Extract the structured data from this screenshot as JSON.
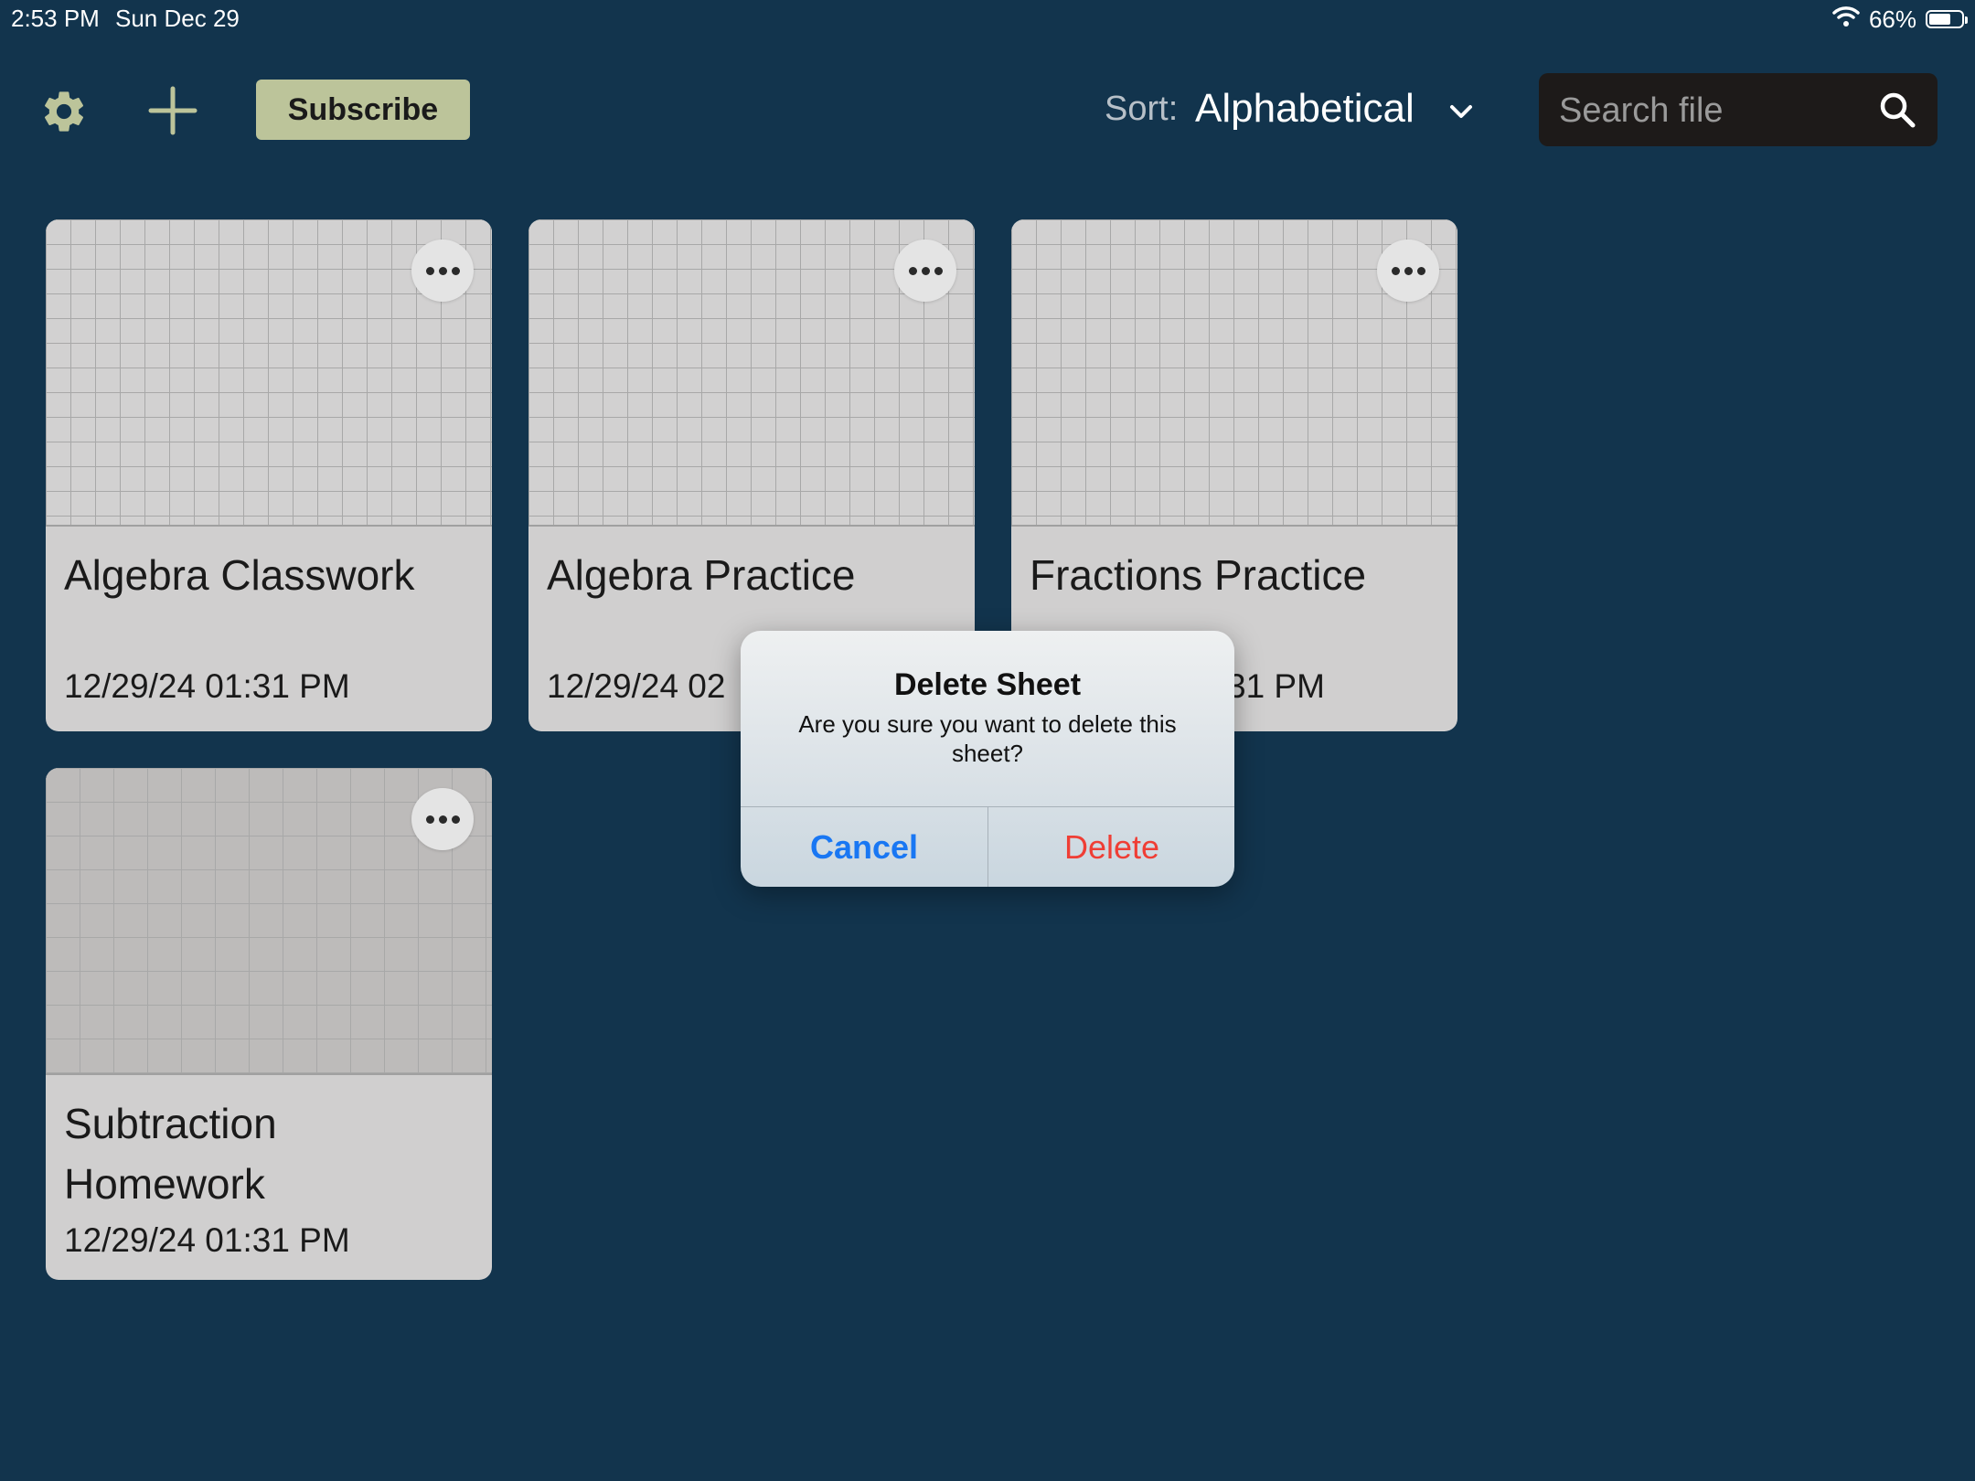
{
  "status_bar": {
    "time": "2:53 PM",
    "date": "Sun Dec 29",
    "battery": "66%"
  },
  "toolbar": {
    "subscribe_label": "Subscribe",
    "sort_label": "Sort:",
    "sort_value": "Alphabetical",
    "search_placeholder": "Search file"
  },
  "icons": {
    "settings": "gear-icon",
    "add": "plus-icon",
    "sort": "chevron-down-icon",
    "search": "search-icon",
    "more": "more-horizontal-icon",
    "wifi": "wifi-icon",
    "battery": "battery-icon"
  },
  "colors": {
    "background": "#12344d",
    "subscribe": "#bcc49a",
    "card": "#d0cfcf",
    "cancel": "#1977f3",
    "delete": "#ef3e35"
  },
  "sheets": [
    {
      "title": "Algebra Classwork",
      "date": "12/29/24 01:31 PM"
    },
    {
      "title": "Algebra Practice",
      "date": "12/29/24 02"
    },
    {
      "title": "Fractions Practice",
      "date": "31 PM"
    },
    {
      "title": "Subtraction Homework",
      "date": "12/29/24 01:31 PM"
    }
  ],
  "dialog": {
    "title": "Delete Sheet",
    "message": "Are you sure you want to delete this sheet?",
    "cancel_label": "Cancel",
    "delete_label": "Delete"
  }
}
